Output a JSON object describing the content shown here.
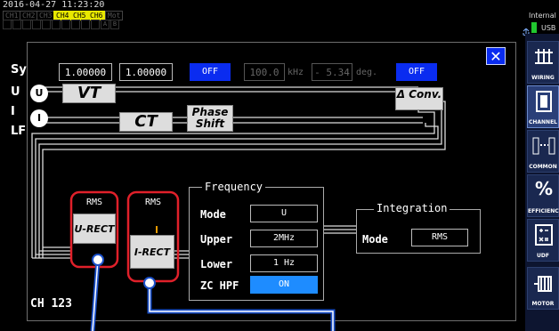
{
  "status": {
    "datetime": "2016-04-27 11:23:20",
    "channels": [
      {
        "label": "CH1",
        "active": false
      },
      {
        "label": "CH2",
        "active": false
      },
      {
        "label": "CH3",
        "active": false
      },
      {
        "label": "CH4",
        "active": true
      },
      {
        "label": "CH5",
        "active": true
      },
      {
        "label": "CH6",
        "active": true
      },
      {
        "label": "Mot",
        "active": false
      }
    ],
    "mini_labels": [
      "A",
      "B"
    ]
  },
  "storage": {
    "label": "Internal",
    "usb_label": "USB"
  },
  "sidebar": {
    "items": [
      {
        "label": "WIRING",
        "icon": "wiring-icon"
      },
      {
        "label": "CHANNEL",
        "icon": "channel-icon"
      },
      {
        "label": "COMMON",
        "icon": "common-icon"
      },
      {
        "label": "EFFICIENCY",
        "icon": "percent-icon"
      },
      {
        "label": "UDF",
        "icon": "udf-icon"
      },
      {
        "label": "MOTOR",
        "icon": "motor-icon"
      }
    ]
  },
  "background": {
    "letters": [
      "Sy",
      "U",
      "I",
      "LF"
    ]
  },
  "dialog": {
    "channel_label": "CH 123",
    "close_label": "✕",
    "vt_value": "1.00000",
    "ct_value": "1.00000",
    "phase_shift_state": "OFF",
    "phase_freq_value": "100.0",
    "phase_freq_unit": "kHz",
    "phase_angle_value": "- 5.34",
    "phase_angle_unit": "deg.",
    "delta_conv_state": "OFF",
    "voltage_marker": "U",
    "current_marker": "I",
    "vt_label": "VT",
    "ct_label": "CT",
    "phase_shift_label": "Phase Shift",
    "delta_conv_label": "Δ Conv.",
    "u_rms": "RMS",
    "i_rms": "RMS",
    "u_rect_label": "U-RECT",
    "i_rect_label": "I-RECT",
    "frequency": {
      "title": "Frequency",
      "mode_label": "Mode",
      "mode_value": "U",
      "upper_label": "Upper",
      "upper_value": "2MHz",
      "lower_label": "Lower",
      "lower_value": "1 Hz",
      "zc_label": "ZC HPF",
      "zc_value": "ON"
    },
    "integration": {
      "title": "Integration",
      "mode_label": "Mode",
      "mode_value": "RMS"
    }
  },
  "colors": {
    "accent": "#0a2cf0",
    "highlight_red": "#e0202a",
    "channel_active": "#e8e800",
    "callout_line": "#1a4fc8"
  }
}
